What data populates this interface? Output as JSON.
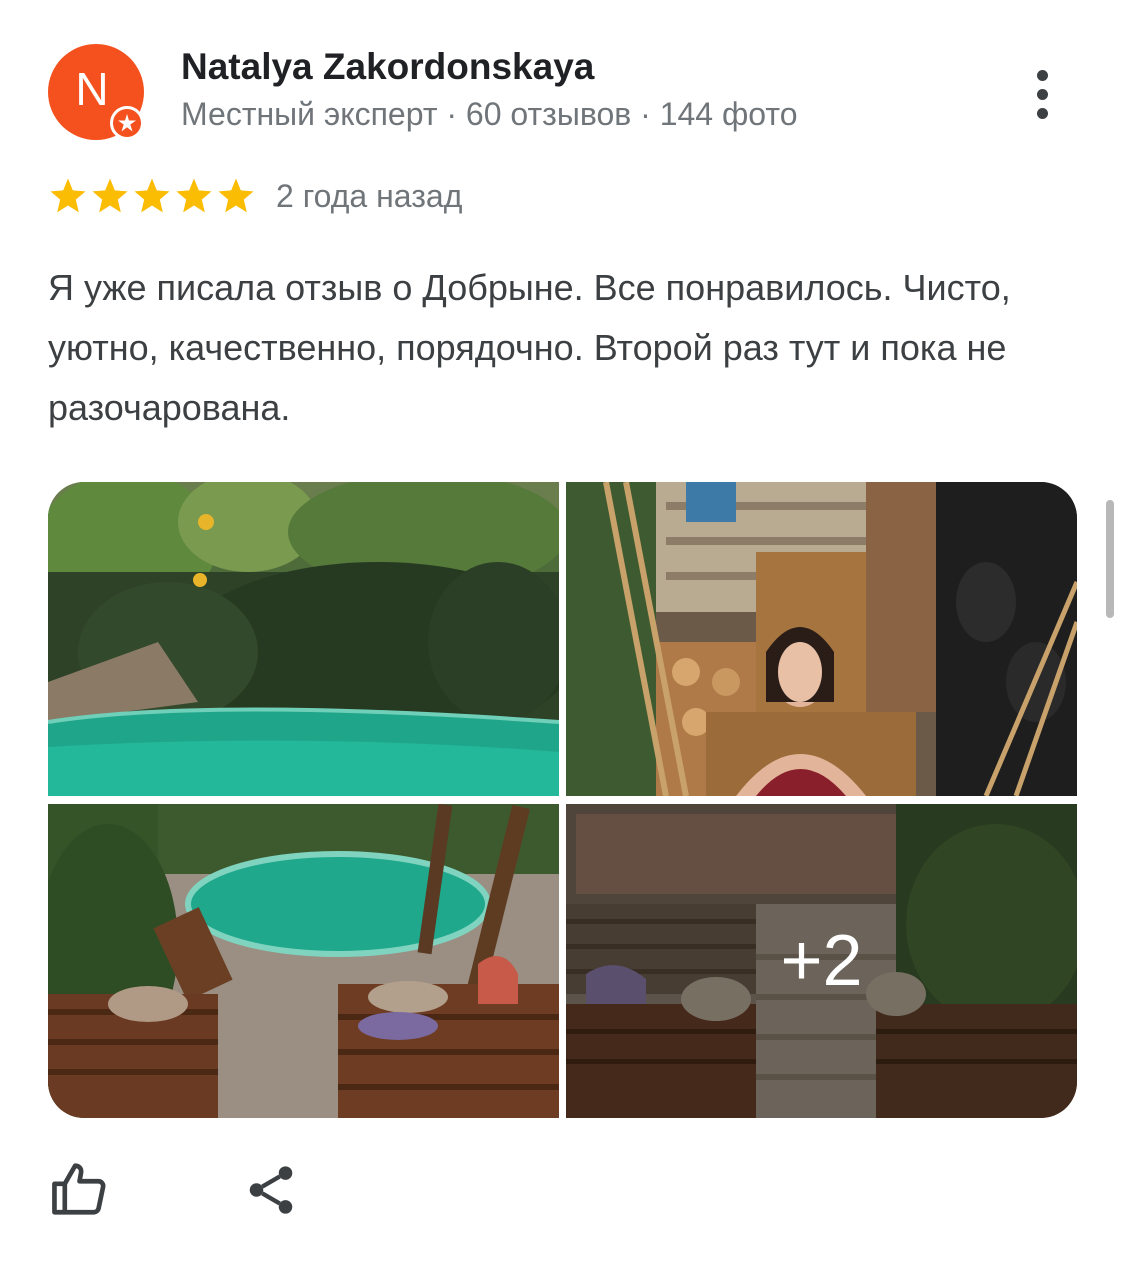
{
  "reviewer": {
    "avatar_letter": "N",
    "avatar_color": "#f4511e",
    "name": "Natalya Zakordonskaya",
    "meta": "Местный эксперт · 60 отзывов · 144 фото"
  },
  "rating": {
    "stars": 5,
    "max": 5,
    "star_color": "#fbbc04"
  },
  "date": "2 года назад",
  "review": {
    "text": "Я уже писала отзыв о Добрыне. Все понравилось. Чисто, уютно, качественно, порядочно. Второй раз тут и пока не разочарована."
  },
  "photos": {
    "more_label": "+2",
    "items": [
      "pool-garden-photo",
      "woman-on-wooden-chair-photo",
      "pool-and-loungers-photo",
      "courtyard-benches-photo"
    ]
  },
  "icons": {
    "more": "more-vertical-icon",
    "like": "thumbs-up-icon",
    "share": "share-icon",
    "badge": "local-guide-star-icon"
  }
}
